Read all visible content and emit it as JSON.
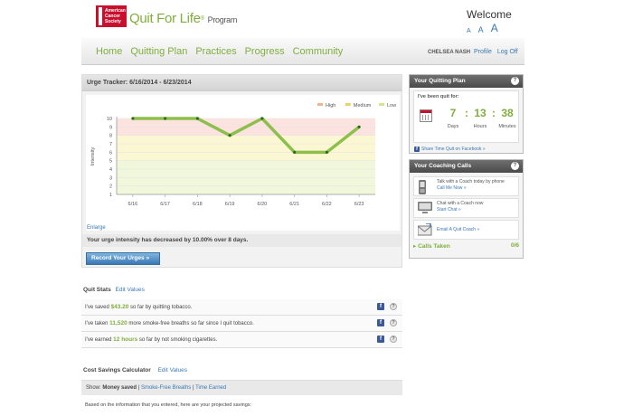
{
  "brand": {
    "acs_text": "American Cancer Society",
    "product_main": "Quit For Life",
    "product_reg": "®",
    "product_suffix": "Program"
  },
  "header": {
    "welcome": "Welcome",
    "font_sizes": [
      "A",
      "A",
      "A"
    ]
  },
  "nav": {
    "items": [
      "Home",
      "Quitting Plan",
      "Practices",
      "Progress",
      "Community"
    ],
    "username": "CHELSEA NASH",
    "profile": "Profile",
    "logoff": "Log Off"
  },
  "urge": {
    "title": "Urge Tracker: 6/16/2014 - 6/23/2014",
    "enlarge": "Enlarge",
    "message": "Your urge intensity has decreased by 10.00% over 8 days.",
    "record_button": "Record Your Urges »"
  },
  "chart_data": {
    "type": "line",
    "ylabel": "Intensity",
    "categories": [
      "6/16",
      "6/17",
      "6/18",
      "6/19",
      "6/20",
      "6/21",
      "6/22",
      "6/23"
    ],
    "values": [
      10,
      10,
      10,
      8,
      10,
      6,
      6,
      9
    ],
    "ylim": [
      1,
      10
    ],
    "yticks": [
      1,
      2,
      3,
      4,
      5,
      6,
      7,
      8,
      9,
      10
    ],
    "legend": [
      "High",
      "Medium",
      "Low"
    ],
    "legend_position": "top-right",
    "bands": [
      {
        "name": "High",
        "from": 8,
        "to": 10,
        "color": "#fde3e0"
      },
      {
        "name": "Medium",
        "from": 5,
        "to": 8,
        "color": "#fbf7d2"
      },
      {
        "name": "Low",
        "from": 1,
        "to": 5,
        "color": "#f1f7da"
      }
    ],
    "legend_colors": [
      "#f2b28a",
      "#e9d36a",
      "#d6e58c"
    ],
    "line_color": "#8dbf4c"
  },
  "quitting_plan": {
    "title": "Your Quitting Plan",
    "help": "?",
    "label": "I've been quit for:",
    "days": "7",
    "hours": "13",
    "minutes": "38",
    "separator": ":",
    "days_label": "Days",
    "hours_label": "Hours",
    "minutes_label": "Minutes",
    "share": "Share Time Quit on Facebook »"
  },
  "coaching": {
    "title": "Your Coaching Calls",
    "help": "?",
    "rows": [
      {
        "text": "Talk with a Coach today by phone",
        "link": "Call Me Now »"
      },
      {
        "text": "Chat with a Coach now",
        "link": "Start Chat »"
      },
      {
        "text": "",
        "link": "Email A Quit Coach »"
      }
    ],
    "calls_label": "Calls Taken",
    "calls_value": "0/6"
  },
  "quit_stats": {
    "title": "Quit Stats",
    "edit": "Edit Values",
    "rows": [
      {
        "pre": "I've saved ",
        "value": "$43.20",
        "post": " so far by quitting tobacco."
      },
      {
        "pre": "I've taken ",
        "value": "11,520",
        "post": " more smoke-free breaths so far since I quit tobacco."
      },
      {
        "pre": "I've earned ",
        "value": "12 hours",
        "post": " so far by not smoking cigarettes."
      }
    ],
    "fb": "f",
    "help": "?"
  },
  "calculator": {
    "title": "Cost Savings Calculator",
    "edit": "Edit Values",
    "show": "Show:",
    "selected": "Money saved",
    "option2": "Smoke-Free Breaths",
    "option3": "Time Earned",
    "sep": "|",
    "note": "Based on the information that you entered, here are your projected savings:"
  }
}
